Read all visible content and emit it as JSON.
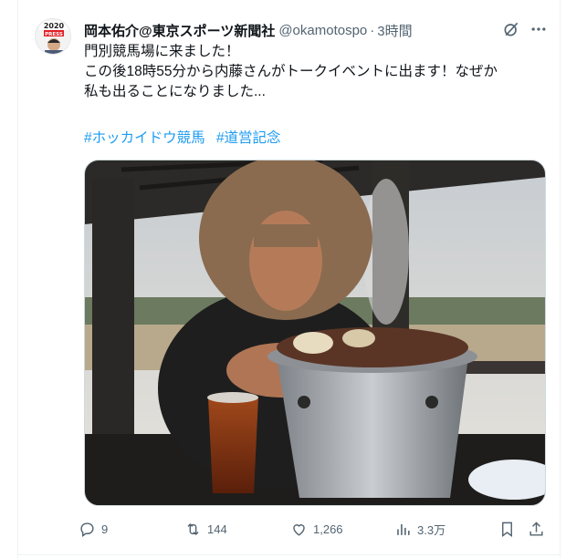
{
  "tweet": {
    "display_name": "岡本佑介@東京スポーツ新聞社",
    "handle": "@okamotospo",
    "separator": "·",
    "time": "3時間",
    "lines": [
      "門別競馬場に来ました！",
      "この後18時55分から内藤さんがトークイベントに出ます！なぜか",
      "私も出ることになりました..."
    ],
    "hashtags": [
      "#ホッカイドウ競馬",
      "#道営記念"
    ]
  },
  "avatar": {
    "badge_year": "2020",
    "badge_text": "PRESS"
  },
  "actions": {
    "replies": "9",
    "reposts": "144",
    "likes": "1,266",
    "views": "3.3万"
  },
  "icons": {
    "grok": "grok-icon",
    "more": "more-icon",
    "reply": "reply-icon",
    "repost": "repost-icon",
    "like": "heart-icon",
    "views": "analytics-icon",
    "bookmark": "bookmark-icon",
    "share": "share-icon"
  },
  "colors": {
    "text": "#0f1419",
    "muted": "#536471",
    "link": "#1d9bf0",
    "border": "#eff3f4"
  }
}
